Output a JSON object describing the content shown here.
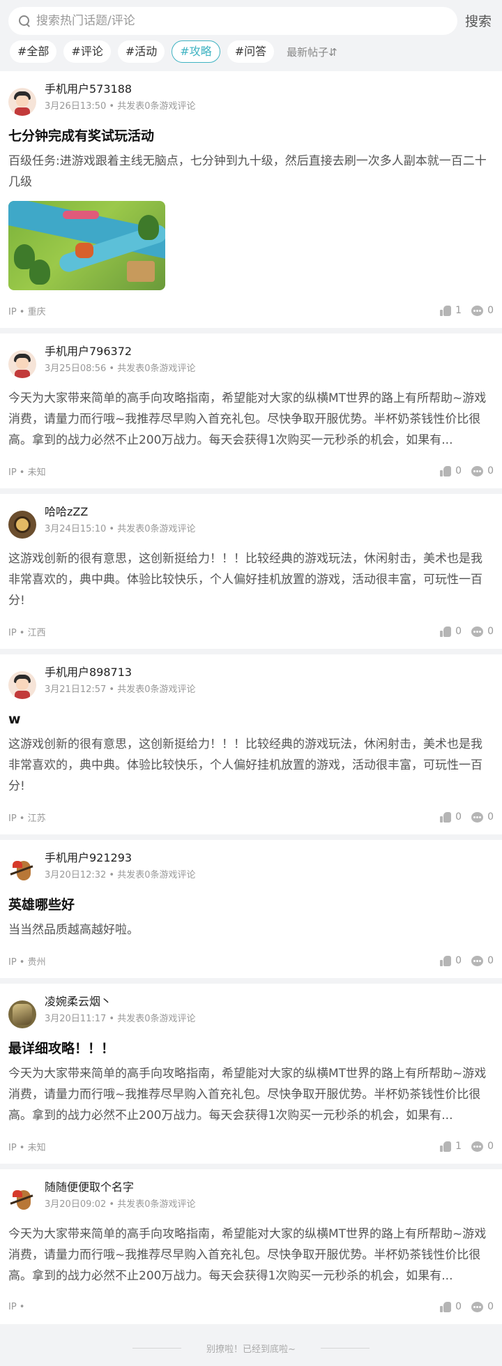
{
  "search": {
    "placeholder": "搜索热门话题/评论",
    "button": "搜索"
  },
  "tags": [
    "#全部",
    "#评论",
    "#活动",
    "#攻略",
    "#问答"
  ],
  "active_tag": "#攻略",
  "sort_label": "最新帖子⇵",
  "posts": [
    {
      "username": "手机用户573188",
      "meta": "3月26日13:50 • 共发表0条游戏评论",
      "title": "七分钟完成有奖试玩活动",
      "body": "百级任务:进游戏跟着主线无脑点，七分钟到九十级，然后直接去刷一次多人副本就一百二十几级",
      "location": "IP • 重庆",
      "likes": "1",
      "comments": "0"
    },
    {
      "username": "手机用户796372",
      "meta": "3月25日08:56 • 共发表0条游戏评论",
      "body": "今天为大家带来简单的高手向攻略指南，希望能对大家的纵横MT世界的路上有所帮助~游戏消费，请量力而行哦~我推荐尽早购入首充礼包。尽快争取开服优势。半杯奶茶钱性价比很高。拿到的战力必然不止200万战力。每天会获得1次购买一元秒杀的机会，如果有...",
      "location": "IP • 未知",
      "likes": "0",
      "comments": "0"
    },
    {
      "username": "哈哈zZZ",
      "meta": "3月24日15:10 • 共发表0条游戏评论",
      "body": "这游戏创新的很有意思，这创新挺给力！！！比较经典的游戏玩法，休闲射击，美术也是我非常喜欢的，典中典。体验比较快乐，个人偏好挂机放置的游戏，活动很丰富，可玩性一百分!",
      "location": "IP • 江西",
      "likes": "0",
      "comments": "0"
    },
    {
      "username": "手机用户898713",
      "meta": "3月21日12:57 • 共发表0条游戏评论",
      "title": "w",
      "body": "这游戏创新的很有意思，这创新挺给力！！！比较经典的游戏玩法，休闲射击，美术也是我非常喜欢的，典中典。体验比较快乐，个人偏好挂机放置的游戏，活动很丰富，可玩性一百分!",
      "location": "IP • 江苏",
      "likes": "0",
      "comments": "0"
    },
    {
      "username": "手机用户921293",
      "meta": "3月20日12:32 • 共发表0条游戏评论",
      "title": "英雄哪些好",
      "body": "当当然品质越高越好啦。",
      "location": "IP • 贵州",
      "likes": "0",
      "comments": "0"
    },
    {
      "username": "凌婉柔云烟丶",
      "meta": "3月20日11:17 • 共发表0条游戏评论",
      "title": "最详细攻略！！！",
      "body": "今天为大家带来简单的高手向攻略指南，希望能对大家的纵横MT世界的路上有所帮助~游戏消费，请量力而行哦~我推荐尽早购入首充礼包。尽快争取开服优势。半杯奶茶钱性价比很高。拿到的战力必然不止200万战力。每天会获得1次购买一元秒杀的机会，如果有...",
      "location": "IP • 未知",
      "likes": "1",
      "comments": "0"
    },
    {
      "username": "随随便便取个名字",
      "meta": "3月20日09:02 • 共发表0条游戏评论",
      "body": "今天为大家带来简单的高手向攻略指南，希望能对大家的纵横MT世界的路上有所帮助~游戏消费，请量力而行哦~我推荐尽早购入首充礼包。尽快争取开服优势。半杯奶茶钱性价比很高。拿到的战力必然不止200万战力。每天会获得1次购买一元秒杀的机会，如果有...",
      "location": "IP •",
      "likes": "0",
      "comments": "0"
    }
  ],
  "end_text": "别撩啦！已经到底啦~",
  "colors": {
    "accent": "#3fb3c2",
    "background": "#f2f3f5"
  }
}
